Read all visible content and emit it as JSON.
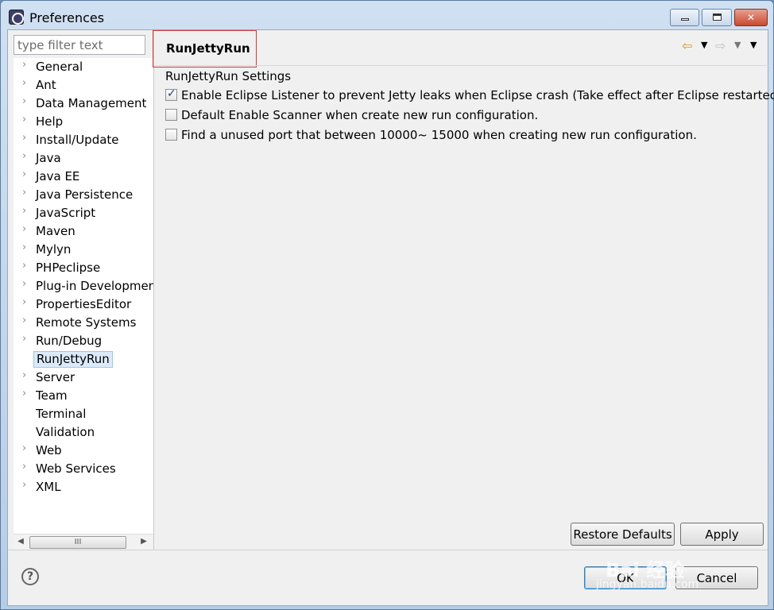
{
  "window": {
    "title": "Preferences",
    "minimize_label": "",
    "maximize_label": "",
    "close_label": "✕"
  },
  "filter": {
    "placeholder": "type filter text",
    "value": ""
  },
  "tree": {
    "items": [
      {
        "label": "General",
        "expandable": true
      },
      {
        "label": "Ant",
        "expandable": true
      },
      {
        "label": "Data Management",
        "expandable": true
      },
      {
        "label": "Help",
        "expandable": true
      },
      {
        "label": "Install/Update",
        "expandable": true
      },
      {
        "label": "Java",
        "expandable": true
      },
      {
        "label": "Java EE",
        "expandable": true
      },
      {
        "label": "Java Persistence",
        "expandable": true
      },
      {
        "label": "JavaScript",
        "expandable": true
      },
      {
        "label": "Maven",
        "expandable": true
      },
      {
        "label": "Mylyn",
        "expandable": true
      },
      {
        "label": "PHPeclipse",
        "expandable": true
      },
      {
        "label": "Plug-in Development",
        "expandable": true
      },
      {
        "label": "PropertiesEditor",
        "expandable": true
      },
      {
        "label": "Remote Systems",
        "expandable": true
      },
      {
        "label": "Run/Debug",
        "expandable": true
      },
      {
        "label": "RunJettyRun",
        "expandable": false,
        "selected": true
      },
      {
        "label": "Server",
        "expandable": true
      },
      {
        "label": "Team",
        "expandable": true
      },
      {
        "label": "Terminal",
        "expandable": false
      },
      {
        "label": "Validation",
        "expandable": false
      },
      {
        "label": "Web",
        "expandable": true
      },
      {
        "label": "Web Services",
        "expandable": true
      },
      {
        "label": "XML",
        "expandable": true
      }
    ],
    "scroll_left": "◀",
    "scroll_right": "▶",
    "scroll_thumb": "III"
  },
  "page": {
    "title": "RunJettyRun",
    "section_label": "RunJettyRun Settings",
    "options": [
      {
        "label": "Enable Eclipse Listener to prevent Jetty leaks when Eclipse crash (Take effect after Eclipse restarted).",
        "checked": true
      },
      {
        "label": "Default Enable Scanner when create new run configuration.",
        "checked": false
      },
      {
        "label": "Find a unused port that between 10000~ 15000 when creating new run configuration.",
        "checked": false
      }
    ]
  },
  "nav": {
    "back_icon": "⇦",
    "forward_icon": "⇨",
    "dropdown_icon": "▼"
  },
  "buttons": {
    "restore_defaults": "Restore Defaults",
    "apply": "Apply",
    "ok": "OK",
    "cancel": "Cancel",
    "help": "?"
  },
  "watermark": {
    "text": "Bai 经验",
    "sub": "jingyan.baidu.com"
  },
  "colors": {
    "accent": "#3c7fb1",
    "title_highlight": "#d23a3a",
    "selection": "#dbeaf9"
  }
}
